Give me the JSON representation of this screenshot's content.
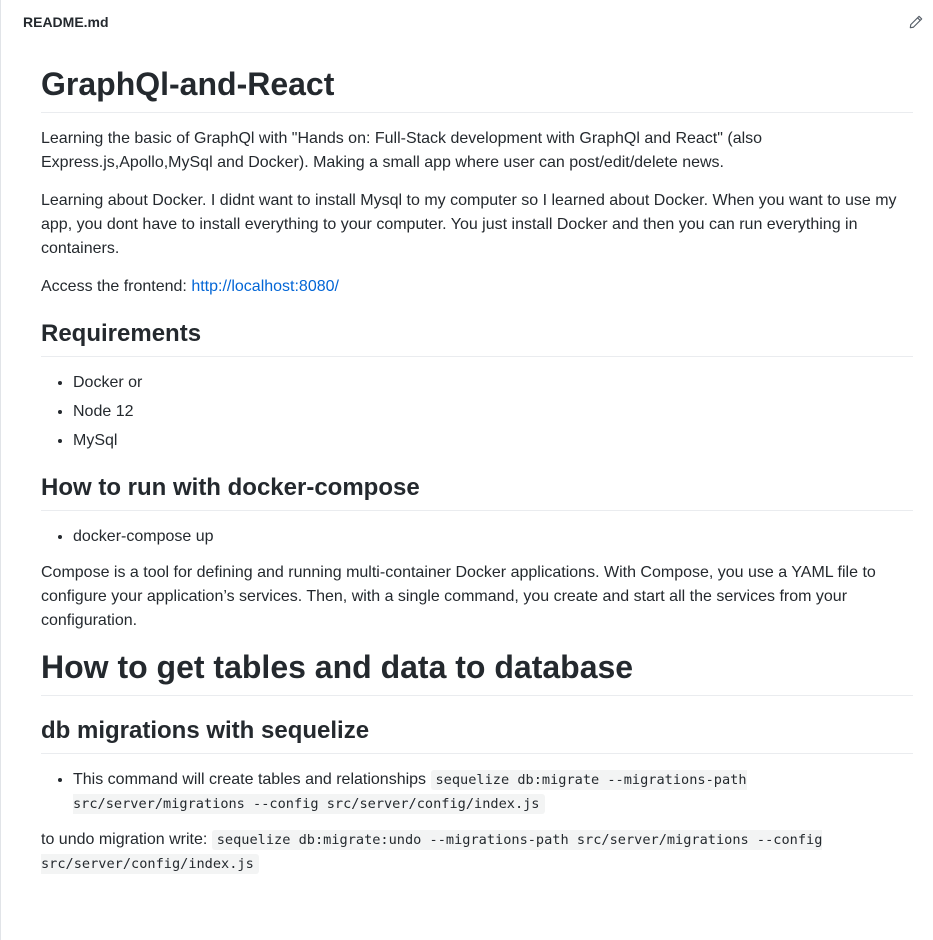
{
  "header": {
    "file_name": "README.md",
    "edit_icon": "pencil-icon"
  },
  "readme": {
    "title": "GraphQl-and-React",
    "intro_p1": "Learning the basic of GraphQl with \"Hands on: Full-Stack development with GraphQl and React\" (also Express.js,Apollo,MySql and Docker). Making a small app where user can post/edit/delete news.",
    "intro_p2": "Learning about Docker. I didnt want to install Mysql to my computer so I learned about Docker. When you want to use my app, you dont have to install everything to your computer. You just install Docker and then you can run everything in containers.",
    "access_label": "Access the frontend: ",
    "access_link": "http://localhost:8080/",
    "requirements_heading": "Requirements",
    "requirements": [
      "Docker or",
      "Node 12",
      "MySql"
    ],
    "run_heading": "How to run with docker-compose",
    "run_items": [
      "docker-compose up"
    ],
    "compose_desc": "Compose is a tool for defining and running multi-container Docker applications. With Compose, you use a YAML file to configure your application’s services. Then, with a single command, you create and start all the services from your configuration.",
    "tables_heading": "How to get tables and data to database",
    "migrations_heading": "db migrations with sequelize",
    "migration_item_text": "This command will create tables and relationships ",
    "migration_item_code": "sequelize db:migrate --migrations-path src/server/migrations --config src/server/config/index.js",
    "undo_text": "to undo migration write: ",
    "undo_code": "sequelize db:migrate:undo --migrations-path src/server/migrations --config src/server/config/index.js"
  }
}
